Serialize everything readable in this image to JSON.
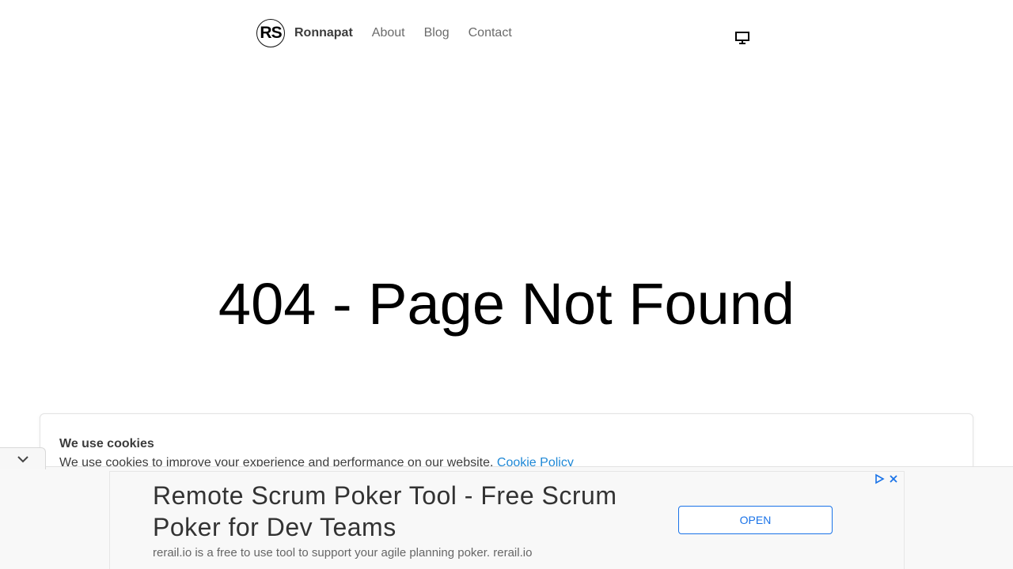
{
  "header": {
    "logo_text": "RS",
    "brand": "Ronnapat",
    "nav": [
      {
        "label": "About"
      },
      {
        "label": "Blog"
      },
      {
        "label": "Contact"
      }
    ],
    "theme_toggle_icon": "monitor-icon"
  },
  "main": {
    "title": "404 - Page Not Found"
  },
  "cookie_banner": {
    "title": "We use cookies",
    "text": "We use cookies to improve your experience and performance on our website.",
    "link_text": "Cookie Policy",
    "link_color": "#1e88d6"
  },
  "collapse_tab": {
    "icon": "chevron-down-icon"
  },
  "ad": {
    "headline": "Remote Scrum Poker Tool - Free Scrum Poker for Dev Teams",
    "description": "rerail.io is a free to use tool to support your agile planning poker. rerail.io",
    "button_label": "OPEN",
    "accent": "#1a73e8",
    "icons": [
      "adchoices-icon",
      "close-icon"
    ]
  }
}
